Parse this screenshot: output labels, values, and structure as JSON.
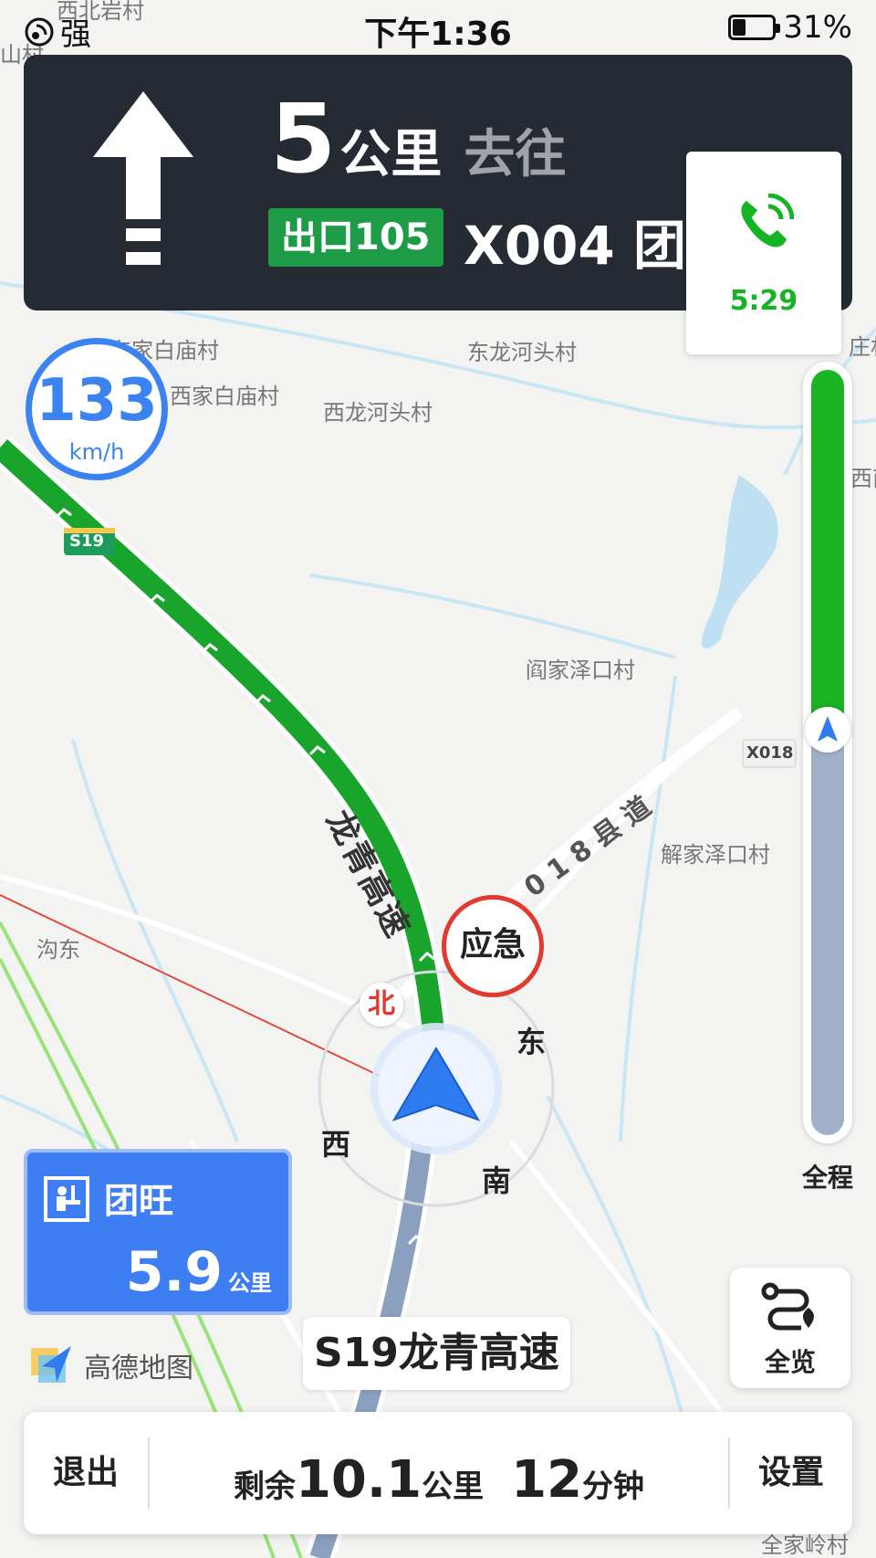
{
  "status_bar": {
    "signal_label": "强",
    "time": "下午1:36",
    "battery_percent": "31%",
    "battery_level": 0.31
  },
  "guidance": {
    "turn_icon": "straight-arrow-icon",
    "distance_value": "5",
    "distance_unit": "公里",
    "go_to_label": "去往",
    "exit_label": "出口105",
    "road_text": "X004  团"
  },
  "call": {
    "icon": "phone-icon",
    "duration": "5:29",
    "color": "#16b424"
  },
  "speed": {
    "value": "133",
    "unit": "km/h",
    "color": "#3a83f0"
  },
  "route_progress": {
    "label": "全程",
    "completed_fraction": 0.47,
    "done_color": "#1bb523",
    "remaining_color": "#9fb0c8"
  },
  "service_area": {
    "icon": "service-area-icon",
    "name": "团旺",
    "distance_value": "5.9",
    "distance_unit": "公里"
  },
  "overview_button": {
    "icon": "route-overview-icon",
    "label": "全览"
  },
  "current_road": "S19龙青高速",
  "logo": {
    "text": "高德地图"
  },
  "bottom_bar": {
    "exit_label": "退出",
    "remain_prefix": "剩余",
    "remain_distance": "10.1",
    "remain_distance_unit": "公里",
    "remain_time": "12",
    "remain_time_unit": "分钟",
    "settings_label": "设置"
  },
  "map": {
    "places": [
      "西北岩村",
      "山村",
      "东家白庙村",
      "西家白庙村",
      "东龙河头村",
      "西龙河头村",
      "阎家泽口村",
      "解家泽口村",
      "沟东",
      "全家岭村",
      "庄村",
      "西南"
    ],
    "road_names": [
      "龙青高速",
      "018县道"
    ],
    "road_shields": [
      "S19",
      "X018"
    ],
    "compass": {
      "north": "北",
      "east": "东",
      "south": "南",
      "west": "西"
    },
    "emergency_label": "应急"
  }
}
